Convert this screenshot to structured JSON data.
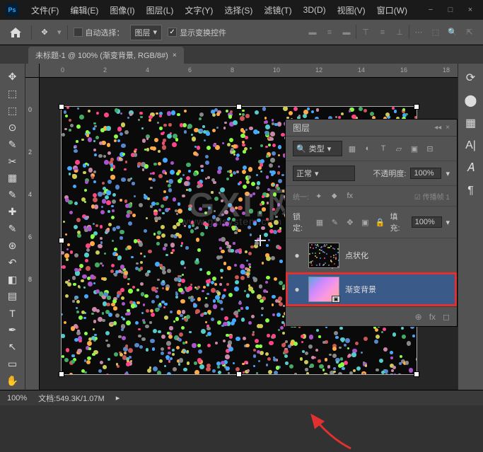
{
  "app": {
    "logo": "Ps"
  },
  "menu": [
    "文件(F)",
    "编辑(E)",
    "图像(I)",
    "图层(L)",
    "文字(Y)",
    "选择(S)",
    "滤镜(T)",
    "3D(D)",
    "视图(V)",
    "窗口(W)"
  ],
  "options": {
    "auto_select": "自动选择：",
    "target": "图层",
    "show_transform": "显示变换控件"
  },
  "tab": {
    "title": "未标题-1 @ 100% (渐变背景, RGB/8#)",
    "close": "×"
  },
  "ruler": {
    "h": [
      "0",
      "2",
      "4",
      "6",
      "8",
      "10",
      "12",
      "14",
      "16",
      "18"
    ],
    "v": [
      "0",
      "2",
      "4",
      "6",
      "8"
    ]
  },
  "watermark": {
    "main": "GXI.网",
    "sub": "www.gxlsystem.com"
  },
  "layers_panel": {
    "title": "图层",
    "filter_label": "类型",
    "blend_mode": "正常",
    "opacity_label": "不透明度:",
    "opacity_value": "100%",
    "spread_label": "传播帧 1",
    "unify_label": "统一:",
    "lock_label": "锁定:",
    "fill_label": "填充:",
    "fill_value": "100%",
    "layers": [
      {
        "name": "点状化",
        "visible": "●"
      },
      {
        "name": "渐变背景",
        "visible": "●"
      }
    ]
  },
  "status": {
    "zoom": "100%",
    "doc_info": "文档:549.3K/1.07M"
  },
  "colors": {
    "highlight": "#e03030"
  }
}
